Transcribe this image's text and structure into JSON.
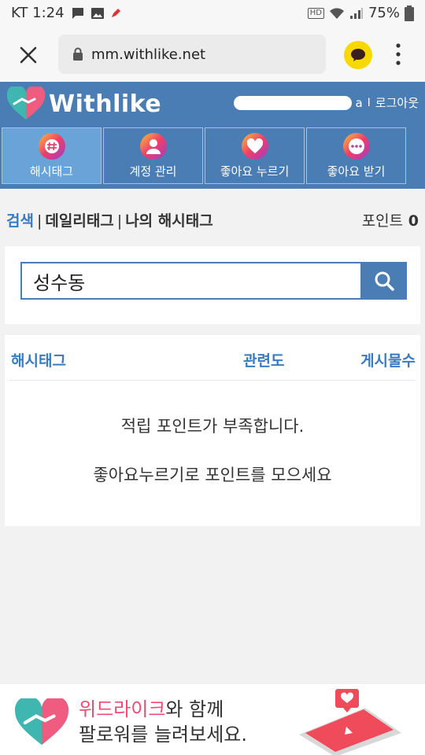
{
  "status_bar": {
    "carrier_time": "KT 1:24",
    "hd_label": "HD",
    "battery": "75%"
  },
  "browser": {
    "url": "mm.withlike.net"
  },
  "header": {
    "logo_text": "Withlike",
    "user_suffix": "a",
    "separator": "I",
    "logout": "로그아웃"
  },
  "tabs": [
    {
      "label": "해시태그",
      "icon": "hashtag-icon",
      "active": true
    },
    {
      "label": "계정 관리",
      "icon": "person-icon",
      "active": false
    },
    {
      "label": "좋아요 누르기",
      "icon": "heart-icon",
      "active": false
    },
    {
      "label": "좋아요 받기",
      "icon": "dots-icon",
      "active": false
    }
  ],
  "subnav": {
    "items": [
      "검색",
      "데일리태그",
      "나의 해시태그"
    ],
    "pipe": "|",
    "points_label": "포인트",
    "points_value": "0"
  },
  "search": {
    "value": "성수동"
  },
  "results": {
    "columns": [
      "해시태그",
      "관련도",
      "게시물수"
    ],
    "message_line1": "적립 포인트가 부족합니다.",
    "message_line2": "좋아요누르기로 포인트를 모으세요"
  },
  "banner": {
    "brand": "위드라이크",
    "line1_rest": "와 함께",
    "line2": "팔로워를 늘려보세요."
  },
  "colors": {
    "header_blue": "#4a7db3",
    "active_tab": "#6aa3d8",
    "link_blue": "#3a7bbf",
    "kakao_yellow": "#f7d800",
    "brand_pink": "#ef4b72"
  }
}
